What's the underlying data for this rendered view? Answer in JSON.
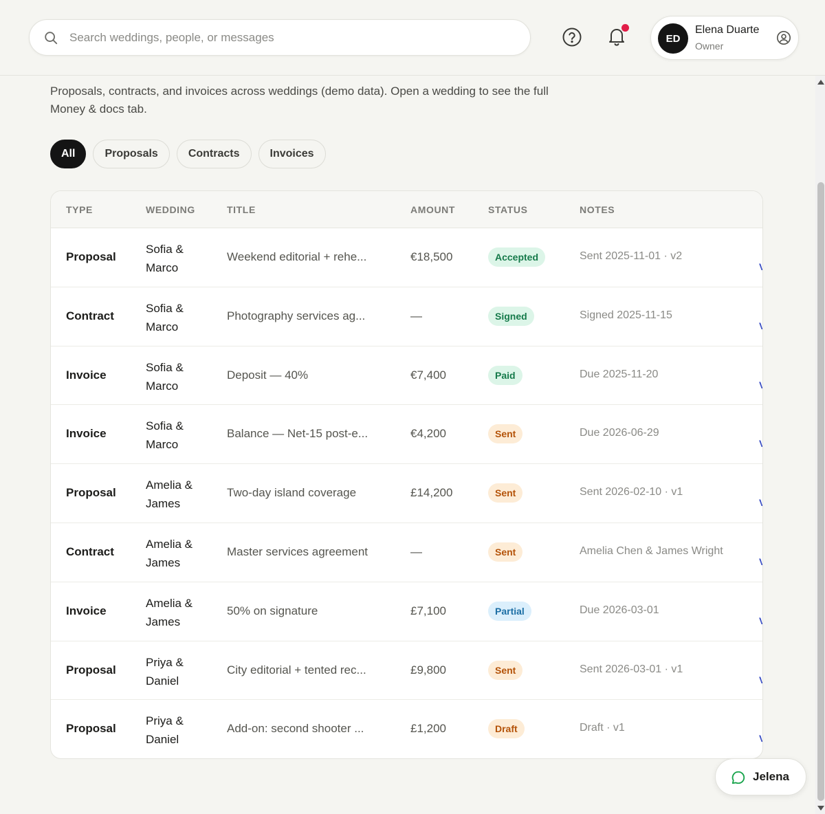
{
  "search": {
    "placeholder": "Search weddings, people, or messages",
    "value": ""
  },
  "user": {
    "initials": "ED",
    "name": "Elena Duarte",
    "role": "Owner"
  },
  "intro": "Proposals, contracts, and invoices across weddings (demo data). Open a wedding to see the full Money & docs tab.",
  "filters": [
    "All",
    "Proposals",
    "Contracts",
    "Invoices"
  ],
  "active_filter": "All",
  "table": {
    "headers": [
      "TYPE",
      "WEDDING",
      "TITLE",
      "AMOUNT",
      "STATUS",
      "NOTES"
    ],
    "rows": [
      {
        "type": "Proposal",
        "wedding": "Sofia & Marco",
        "title": "Weekend editorial + rehe...",
        "amount": "€18,500",
        "status": "Accepted",
        "notes": "Sent 2025-11-01 · v2",
        "link": "V"
      },
      {
        "type": "Contract",
        "wedding": "Sofia & Marco",
        "title": "Photography services ag...",
        "amount": "—",
        "status": "Signed",
        "notes": "Signed 2025-11-15",
        "link": "V"
      },
      {
        "type": "Invoice",
        "wedding": "Sofia & Marco",
        "title": "Deposit — 40%",
        "amount": "€7,400",
        "status": "Paid",
        "notes": "Due 2025-11-20",
        "link": "V"
      },
      {
        "type": "Invoice",
        "wedding": "Sofia & Marco",
        "title": "Balance — Net-15 post-e...",
        "amount": "€4,200",
        "status": "Sent",
        "notes": "Due 2026-06-29",
        "link": "V"
      },
      {
        "type": "Proposal",
        "wedding": "Amelia & James",
        "title": "Two-day island coverage",
        "amount": "£14,200",
        "status": "Sent",
        "notes": "Sent 2026-02-10 · v1",
        "link": "V"
      },
      {
        "type": "Contract",
        "wedding": "Amelia & James",
        "title": "Master services agreement",
        "amount": "—",
        "status": "Sent",
        "notes": "Amelia Chen & James Wright",
        "link": "V"
      },
      {
        "type": "Invoice",
        "wedding": "Amelia & James",
        "title": "50% on signature",
        "amount": "£7,100",
        "status": "Partial",
        "notes": "Due 2026-03-01",
        "link": "V"
      },
      {
        "type": "Proposal",
        "wedding": "Priya & Daniel",
        "title": "City editorial + tented rec...",
        "amount": "£9,800",
        "status": "Sent",
        "notes": "Sent 2026-03-01 · v1",
        "link": "V"
      },
      {
        "type": "Proposal",
        "wedding": "Priya & Daniel",
        "title": "Add-on: second shooter ...",
        "amount": "£1,200",
        "status": "Draft",
        "notes": "Draft · v1",
        "link": "V"
      }
    ]
  },
  "status_colors": {
    "Accepted": {
      "bg": "#dcf5e8",
      "fg": "#157a4a"
    },
    "Signed": {
      "bg": "#dcf5e8",
      "fg": "#157a4a"
    },
    "Paid": {
      "bg": "#dcf5e8",
      "fg": "#157a4a"
    },
    "Sent": {
      "bg": "#fdecd6",
      "fg": "#b45309"
    },
    "Draft": {
      "bg": "#fdecd6",
      "fg": "#b45309"
    },
    "Partial": {
      "bg": "#dbeffc",
      "fg": "#1d6fa5"
    }
  },
  "chat": {
    "label": "Jelena"
  },
  "icons": {
    "search": "search-icon",
    "help": "help-icon",
    "bell": "bell-icon",
    "user": "user-circle-icon",
    "chat": "chat-bubble-icon"
  }
}
